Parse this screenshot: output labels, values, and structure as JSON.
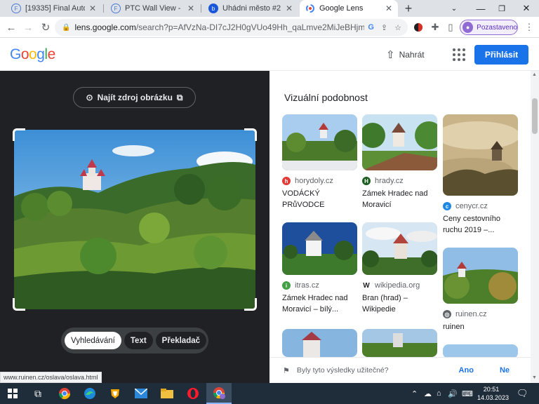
{
  "browser": {
    "tabs": [
      {
        "title": "[19335] Final AutoFauc",
        "favicon": "F"
      },
      {
        "title": "PTC Wall View - Earn w",
        "favicon": "F"
      },
      {
        "title": "Uhádni město #2 [cz]",
        "favicon": "b"
      },
      {
        "title": "Google Lens",
        "favicon": "lens"
      }
    ],
    "active_tab_index": 3,
    "url_domain": "lens.google.com",
    "url_path": "/search?p=AfVzNa-DI7cJ2H0gVUo49Hh_qaLmve2MiJeBHjmf-ywNY...",
    "profile_label": "Pozastaveno"
  },
  "header": {
    "logo": "Google",
    "upload_label": "Nahrát",
    "signin_label": "Přihlásit"
  },
  "left": {
    "find_source_label": "Najít zdroj obrázku",
    "modes": [
      "Vyhledávání",
      "Text",
      "Překladač"
    ],
    "active_mode": 0,
    "status_url": "www.ruinen.cz/oslava/oslava.html"
  },
  "right": {
    "section_title": "Vizuální podobnost",
    "results": [
      {
        "source": "horydoly.cz",
        "title": "VODÁCKÝ PRůVODCE",
        "icon_color": "#e53935",
        "icon": "h"
      },
      {
        "source": "hrady.cz",
        "title": "Zámek Hradec nad Moravicí",
        "icon_color": "#1b5e20",
        "icon": "H"
      },
      {
        "source": "cenycr.cz",
        "title": "Ceny cestovního ruchu 2019 –...",
        "icon_color": "#1e88e5",
        "icon": "c"
      },
      {
        "source": "itras.cz",
        "title": "Zámek Hradec nad Moravicí – bílý...",
        "icon_color": "#43a047",
        "icon": "i"
      },
      {
        "source": "wikipedia.org",
        "title": "Bran (hrad) – Wikipedie",
        "icon_color": "#ffffff",
        "icon": "W"
      },
      {
        "source": "ruinen.cz",
        "title": "ruinen",
        "icon_color": "#5f6368",
        "icon": "globe"
      }
    ],
    "feedback_question": "Byly tyto výsledky užitečné?",
    "feedback_yes": "Ano",
    "feedback_no": "Ne"
  },
  "taskbar": {
    "time": "20:51",
    "date": "14.03.2023"
  }
}
